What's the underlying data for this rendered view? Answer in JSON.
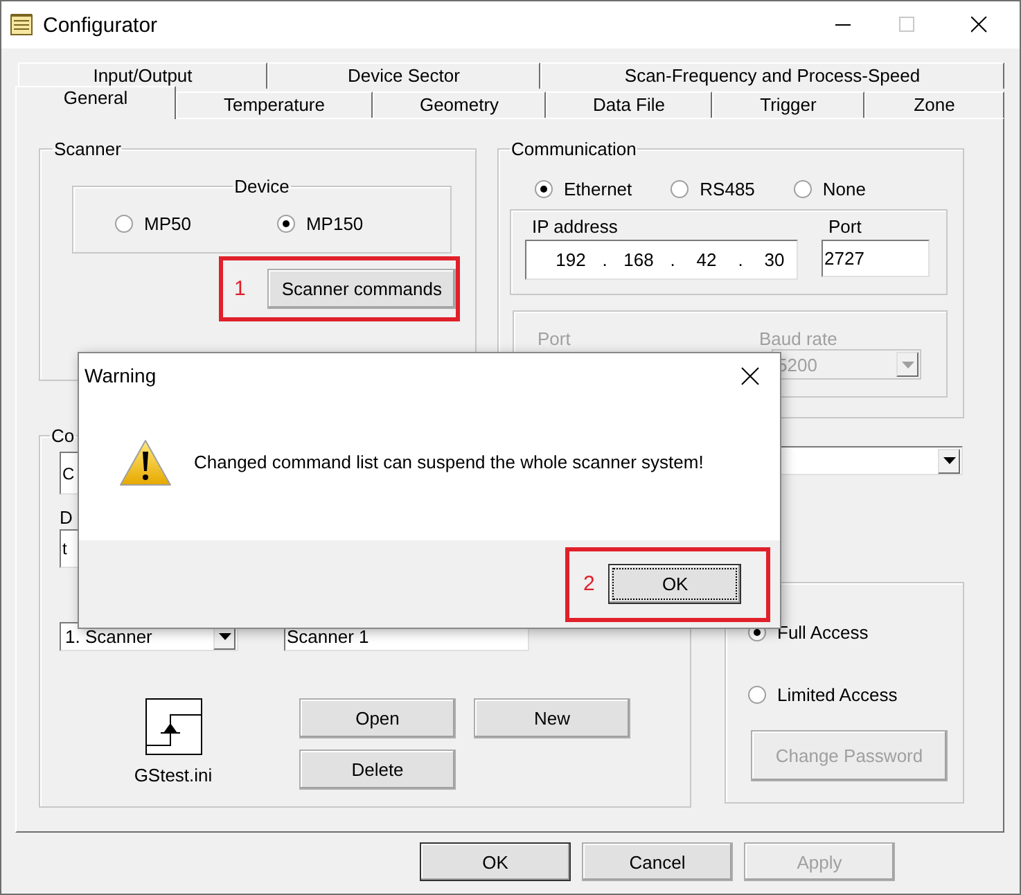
{
  "window": {
    "title": "Configurator"
  },
  "tab_rows": [
    {
      "tabs": [
        {
          "label": "Input/Output",
          "selected": false
        },
        {
          "label": "Device Sector",
          "selected": false
        },
        {
          "label": "Scan-Frequency and Process-Speed",
          "selected": false
        }
      ]
    },
    {
      "tabs": [
        {
          "label": "General",
          "selected": true
        },
        {
          "label": "Temperature",
          "selected": false
        },
        {
          "label": "Geometry",
          "selected": false
        },
        {
          "label": "Data File",
          "selected": false
        },
        {
          "label": "Trigger",
          "selected": false
        },
        {
          "label": "Zone",
          "selected": false
        }
      ]
    }
  ],
  "scanner": {
    "label": "Scanner",
    "device": {
      "label": "Device",
      "options": [
        {
          "label": "MP50",
          "selected": false
        },
        {
          "label": "MP150",
          "selected": true
        }
      ]
    },
    "commands_button": {
      "label": "Scanner commands",
      "callout": "1"
    }
  },
  "communication": {
    "label": "Communication",
    "modes": [
      {
        "label": "Ethernet",
        "selected": true
      },
      {
        "label": "RS485",
        "selected": false
      },
      {
        "label": "None",
        "selected": false
      }
    ],
    "ip": {
      "label": "IP address",
      "octets": [
        "192",
        "168",
        "42",
        "30"
      ],
      "separator": "."
    },
    "port": {
      "label": "Port",
      "value": "2727"
    },
    "serial": {
      "disabled": true,
      "port_label": "Port",
      "baud_label": "Baud rate",
      "baud_value": "5200"
    }
  },
  "configuration": {
    "label": "Co",
    "combo_value": "C",
    "field_label": "D",
    "field_value": "t",
    "scanner_select": "1. Scanner",
    "scanner_name": "Scanner 1",
    "file": "GStest.ini",
    "buttons": [
      {
        "label": "Open",
        "disabled": false
      },
      {
        "label": "New",
        "disabled": false
      },
      {
        "label": "Delete",
        "disabled": false
      }
    ]
  },
  "access": {
    "options": [
      {
        "label": "Full Access",
        "selected": true
      },
      {
        "label": "Limited Access",
        "selected": false
      }
    ],
    "change_password": {
      "label": "Change Password",
      "disabled": true
    }
  },
  "buttons": [
    {
      "label": "OK",
      "disabled": false
    },
    {
      "label": "Cancel",
      "disabled": false
    },
    {
      "label": "Apply",
      "disabled": true
    }
  ],
  "dialog": {
    "title": "Warning",
    "message": "Changed command list can suspend the whole scanner system!",
    "ok": {
      "label": "OK",
      "callout": "2"
    }
  }
}
